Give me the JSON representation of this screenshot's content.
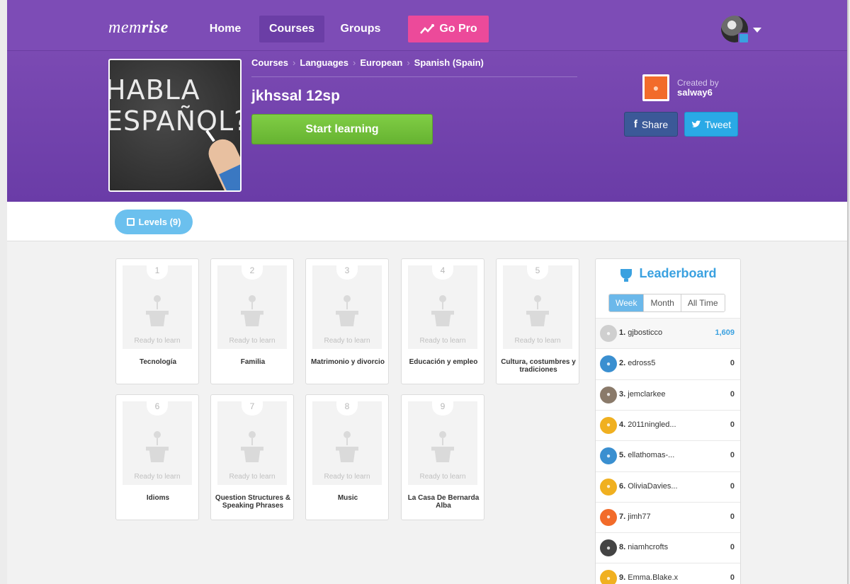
{
  "nav": {
    "logo_pre": "mem",
    "logo_bold": "rise",
    "home": "Home",
    "courses": "Courses",
    "groups": "Groups",
    "gopro": "Go Pro"
  },
  "breadcrumb": [
    "Courses",
    "Languages",
    "European",
    "Spanish (Spain)"
  ],
  "course": {
    "title": "jkhssal 12sp",
    "start_label": "Start learning",
    "image_text_line1": "HABLA",
    "image_text_line2": "ESPAÑOL?",
    "created_by_label": "Created by",
    "creator": "salway6",
    "share_label": "Share",
    "tweet_label": "Tweet"
  },
  "levels_pill": "Levels (9)",
  "ready_label": "Ready to learn",
  "levels": [
    {
      "num": "1",
      "title": "Tecnología"
    },
    {
      "num": "2",
      "title": "Familia"
    },
    {
      "num": "3",
      "title": "Matrimonio y divorcio"
    },
    {
      "num": "4",
      "title": "Educación y empleo"
    },
    {
      "num": "5",
      "title": "Cultura, costumbres y tradiciones"
    },
    {
      "num": "6",
      "title": "Idioms"
    },
    {
      "num": "7",
      "title": "Question Structures & Speaking Phrases"
    },
    {
      "num": "8",
      "title": "Music"
    },
    {
      "num": "9",
      "title": "La Casa De Bernarda Alba"
    }
  ],
  "leaderboard": {
    "title": "Leaderboard",
    "tabs": [
      "Week",
      "Month",
      "All Time"
    ],
    "active_tab": "Week",
    "rows": [
      {
        "rank": "1.",
        "name": "gjbosticco",
        "score": "1,609",
        "color": "#cfcfcf"
      },
      {
        "rank": "2.",
        "name": "edross5",
        "score": "0",
        "color": "#3a8fd0"
      },
      {
        "rank": "3.",
        "name": "jemclarkee",
        "score": "0",
        "color": "#8a7a6a"
      },
      {
        "rank": "4.",
        "name": "2011ningled...",
        "score": "0",
        "color": "#f0b020"
      },
      {
        "rank": "5.",
        "name": "ellathomas-...",
        "score": "0",
        "color": "#3a8fd0"
      },
      {
        "rank": "6.",
        "name": "OliviaDavies...",
        "score": "0",
        "color": "#f0b020"
      },
      {
        "rank": "7.",
        "name": "jimh77",
        "score": "0",
        "color": "#f26b2a"
      },
      {
        "rank": "8.",
        "name": "niamhcrofts",
        "score": "0",
        "color": "#444444"
      },
      {
        "rank": "9.",
        "name": "Emma.Blake.x",
        "score": "0",
        "color": "#f0b020"
      }
    ]
  }
}
